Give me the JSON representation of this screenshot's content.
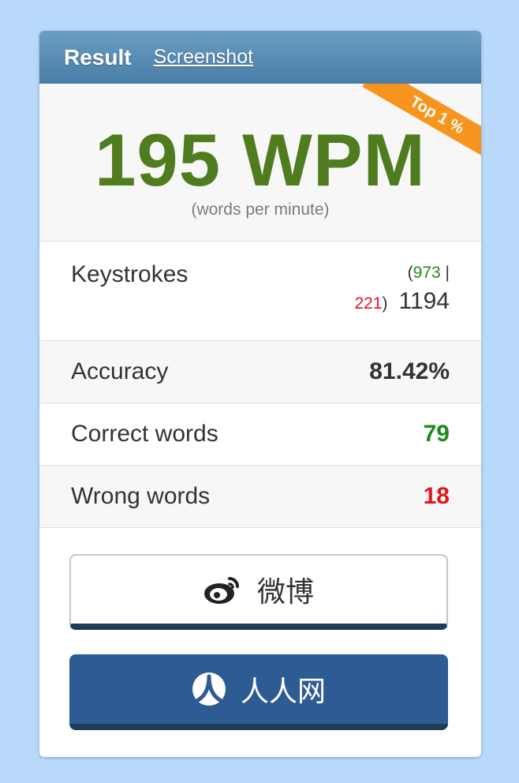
{
  "header": {
    "title": "Result",
    "screenshot_link": "Screenshot"
  },
  "wpm": {
    "value": "195 WPM",
    "unit": "(words per minute)",
    "badge": "Top 1 %"
  },
  "keystrokes": {
    "label": "Keystrokes",
    "correct": "973",
    "separator": "|",
    "wrong": "221",
    "total": "1194",
    "open_paren": "(",
    "close_paren": ")"
  },
  "accuracy": {
    "label": "Accuracy",
    "value": "81.42%"
  },
  "correct_words": {
    "label": "Correct words",
    "value": "79"
  },
  "wrong_words": {
    "label": "Wrong words",
    "value": "18"
  },
  "share": {
    "weibo_label": "微博",
    "renren_label": "人人网"
  },
  "colors": {
    "wpm_green": "#4f7c1e",
    "correct_green": "#1c8a1c",
    "wrong_red": "#e2151b",
    "badge_orange": "#f7941d",
    "renren_blue": "#2e5b94"
  },
  "icons": {
    "weibo": "weibo-icon",
    "renren": "renren-icon"
  }
}
